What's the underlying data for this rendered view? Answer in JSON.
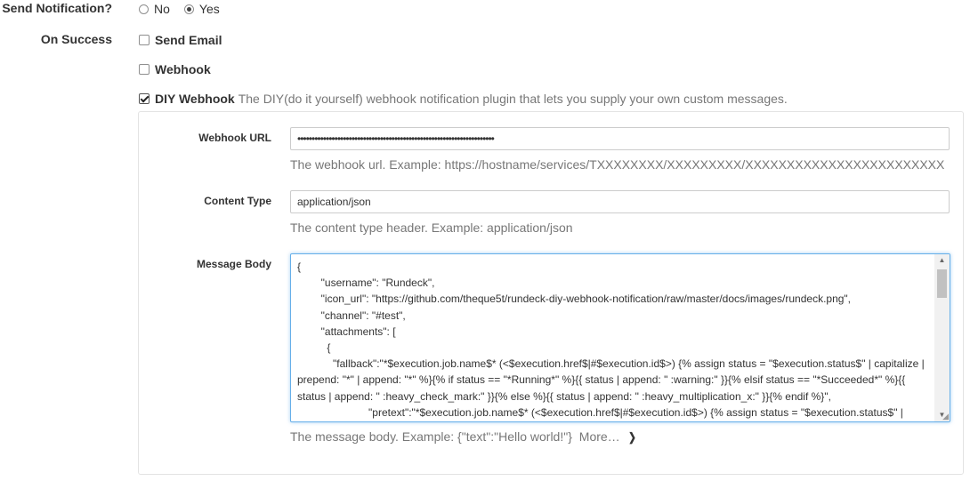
{
  "notification": {
    "label": "Send Notification?",
    "options": [
      {
        "label": "No",
        "checked": false
      },
      {
        "label": "Yes",
        "checked": true
      }
    ]
  },
  "on_success": {
    "label": "On Success",
    "send_email": "Send Email",
    "webhook": "Webhook",
    "diy_webhook": "DIY Webhook",
    "diy_description": "The DIY(do it yourself) webhook notification plugin that lets you supply your own custom messages."
  },
  "form": {
    "webhook_url": {
      "label": "Webhook URL",
      "value": "•••••••••••••••••••••••••••••••••••••••••••••••••••••••••••••••••••••",
      "help": "The webhook url. Example: https://hostname/services/TXXXXXXXX/XXXXXXXXX/XXXXXXXXXXXXXXXXXXXXXXXX"
    },
    "content_type": {
      "label": "Content Type",
      "value": "application/json",
      "help": "The content type header. Example: application/json"
    },
    "message_body": {
      "label": "Message Body",
      "value": "{\n        \"username\": \"Rundeck\",\n        \"icon_url\": \"https://github.com/theque5t/rundeck-diy-webhook-notification/raw/master/docs/images/rundeck.png\",\n        \"channel\": \"#test\",\n        \"attachments\": [\n          {\n            \"fallback\":\"*$execution.job.name$* (<$execution.href$|#$execution.id$>) {% assign status = \"$execution.status$\" | capitalize | prepend: \"*\" | append: \"*\" %}{% if status == \"*Running*\" %}{{ status | append: \" :warning:\" }}{% elsif status == \"*Succeeded*\" %}{{ status | append: \" :heavy_check_mark:\" }}{% else %}{{ status | append: \" :heavy_multiplication_x:\" }}{% endif %}\",\n                        \"pretext\":\"*$execution.job.name$* (<$execution.href$|#$execution.id$>) {% assign status = \"$execution.status$\" |",
      "help": "The message body. Example: {\"text\":\"Hello world!\"}",
      "more": "More…"
    }
  }
}
